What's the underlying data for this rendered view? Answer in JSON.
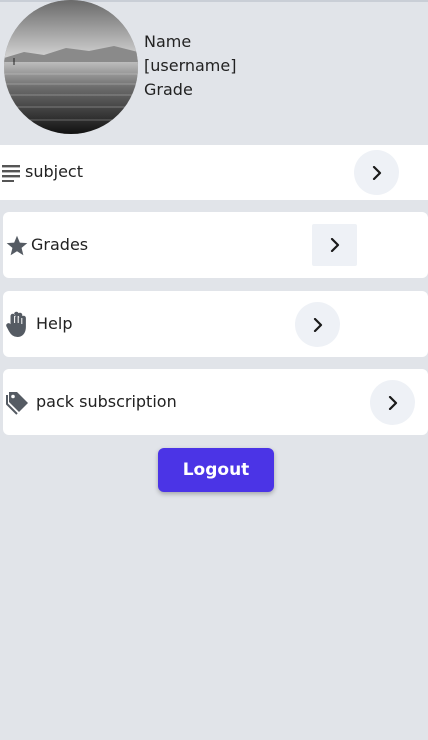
{
  "profile": {
    "name_label": "Name",
    "username": "[username]",
    "grade_label": "Grade"
  },
  "menu": {
    "items": [
      {
        "label": "subject",
        "icon": "list-lines-icon"
      },
      {
        "label": "Grades",
        "icon": "star-icon"
      },
      {
        "label": "Help",
        "icon": "hand-icon"
      },
      {
        "label": "pack subscription",
        "icon": "tag-icon"
      }
    ]
  },
  "logout": {
    "label": "Logout"
  },
  "colors": {
    "background": "#e1e4e9",
    "accent": "#4b34e6",
    "card": "#ffffff",
    "chevron_bg": "#eef1f6"
  }
}
